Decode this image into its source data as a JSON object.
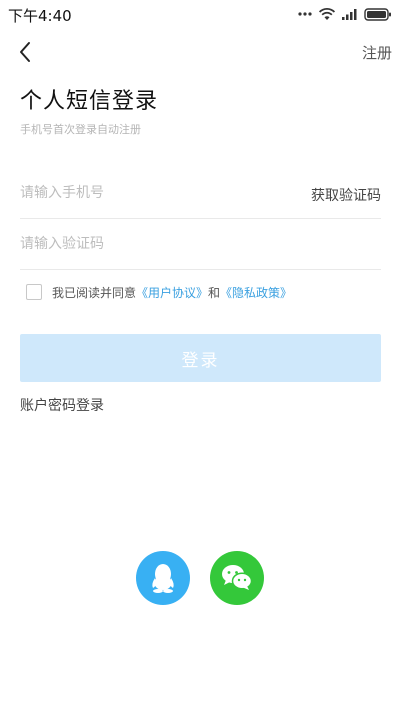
{
  "status_bar": {
    "time": "下午4:40",
    "icons": [
      "more-dots-icon",
      "wifi-icon",
      "signal-icon",
      "battery-icon"
    ]
  },
  "nav": {
    "back_icon": "chevron-left-icon",
    "register_label": "注册"
  },
  "header": {
    "title": "个人短信登录",
    "subtitle": "手机号首次登录自动注册"
  },
  "form": {
    "phone_placeholder": "请输入手机号",
    "get_code_label": "获取验证码",
    "code_placeholder": "请输入验证码"
  },
  "agreement": {
    "prefix": "我已阅读并同意",
    "user_agreement": "《用户协议》",
    "and": "和",
    "privacy_policy": "《隐私政策》",
    "checked": false
  },
  "login_button": {
    "label": "登录"
  },
  "password_login_label": "账户密码登录",
  "social": [
    {
      "name": "qq",
      "icon": "qq-penguin-icon",
      "color": "#38b0f3"
    },
    {
      "name": "wechat",
      "icon": "wechat-icon",
      "color": "#34c83a"
    }
  ],
  "colors": {
    "accent_link": "#3aa0e0",
    "login_button_disabled": "#cfe8fb"
  }
}
